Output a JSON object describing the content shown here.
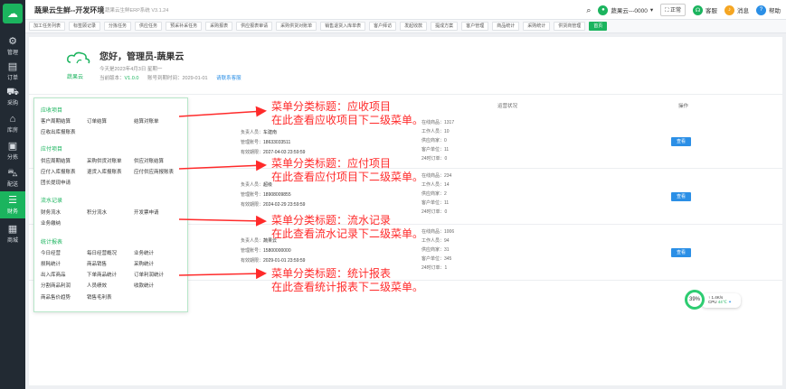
{
  "sidebar": {
    "items": [
      {
        "label": "管理",
        "icon": "gear-icon"
      },
      {
        "label": "订单",
        "icon": "document-icon"
      },
      {
        "label": "采购",
        "icon": "cart-icon"
      },
      {
        "label": "库房",
        "icon": "home-icon"
      },
      {
        "label": "分拣",
        "icon": "box-icon"
      },
      {
        "label": "配送",
        "icon": "truck-icon"
      },
      {
        "label": "财务",
        "icon": "database-icon"
      },
      {
        "label": "商城",
        "icon": "grid-icon"
      }
    ]
  },
  "header": {
    "title": "蔬果云生鲜--开发环境",
    "subtitle": "蔬果云生鲜ERP系统  V3.1.24",
    "user": "蔬果云---0000",
    "mode": "正常",
    "service": "客服",
    "message": "消息",
    "help": "帮助"
  },
  "tabs": [
    "加工任务列表",
    "标签顾记录",
    "分拣任务",
    "供应任务",
    "预采补采任务",
    "采购报表",
    "供应报表审请",
    "采购供货对账单",
    "销售退货入库单表",
    "客户拜访",
    "发起收款",
    "提成方案",
    "客户管理",
    "商品统计",
    "采购统计",
    "供货商管理",
    "首页"
  ],
  "welcome": {
    "hello": "您好，管理员-蔬果云",
    "logo_text": "蔬果云",
    "date": "今天是2023年4月3日 星期一",
    "version_label": "当前版本：",
    "version": "V1.0.0",
    "expire": "账号到期时间：2029-01-01",
    "renew": "请联系客服"
  },
  "table": {
    "col_status": "运营状况",
    "col_action": "操作"
  },
  "rows": [
    {
      "person_label": "负责人员：",
      "person": "车建南",
      "phone_label": "管理账号：",
      "phone": "18633033511",
      "valid_label": "有效期限：",
      "valid": "2027-04-03 23:59:59",
      "stats": [
        "在线商品：1317",
        "工作人员：10",
        "供应商家：0",
        "客户单位：11",
        "24时订单：0"
      ]
    },
    {
      "person_label": "负责人员：",
      "person": "超级",
      "phone_label": "管理账号：",
      "phone": "18908009855",
      "valid_label": "有效期限：",
      "valid": "2024-02-29 23:59:59",
      "stats": [
        "在线商品：234",
        "工作人员：14",
        "供应商家：2",
        "客户单位：11",
        "24时订单：0"
      ]
    },
    {
      "person_label": "负责人员：",
      "person": "蔬果云",
      "phone_label": "管理账号：",
      "phone": "15800000000",
      "valid_label": "有效期限：",
      "valid": "2029-01-01 23:59:59",
      "stats": [
        "在线商品：1006",
        "工作人员：94",
        "供应商家：31",
        "客户单位：345",
        "24时订单：1"
      ]
    }
  ],
  "view_label": "查看",
  "menu": {
    "sections": [
      {
        "title": "应收项目",
        "items": [
          [
            "客户周期结算",
            "订单结算",
            "结算对账单"
          ],
          [
            "应收出库报账表"
          ]
        ]
      },
      {
        "title": "应付项目",
        "items": [
          [
            "供应周期结算",
            "采购供货对账单",
            "供应对账结算"
          ],
          [
            "应付入库报账表",
            "退货入库报账表",
            "应付供应商报账表"
          ],
          [
            "团长提现申请"
          ]
        ]
      },
      {
        "title": "流水记录",
        "items": [
          [
            "财务流水",
            "积分流水",
            "开发票申请"
          ],
          [
            "业务缴纳"
          ]
        ]
      },
      {
        "title": "统计报表",
        "items": [
          [
            "今日经营",
            "每日经营概况",
            "业务统计"
          ],
          [
            "损耗统计",
            "商品销售",
            "采购统计"
          ],
          [
            "出入库商品",
            "下单商品统计",
            "订单利润统计"
          ],
          [
            "分割商品利润",
            "人员绩效",
            "收款统计"
          ],
          [
            "商品售价趋势",
            "销售毛利表"
          ]
        ]
      }
    ]
  },
  "annotations": [
    {
      "line1": "菜单分类标题：应收项目",
      "line2": "在此查看应收项目下二级菜单。"
    },
    {
      "line1": "菜单分类标题：应付项目",
      "line2": "在此查看应付项目下二级菜单。"
    },
    {
      "line1": "菜单分类标题：流水记录",
      "line2": "在此查看流水记录下二级菜单。"
    },
    {
      "line1": "菜单分类标题：统计报表",
      "line2": "在此查看统计报表下二级菜单。"
    }
  ],
  "cpu": {
    "percent": "39%",
    "speed": "1.4K/s",
    "label_cpu": "CPU",
    "cpu_value": "44℃"
  },
  "colors": {
    "accent": "#1bb45e",
    "annotation": "#ff2a2a",
    "link": "#2b8fe6",
    "sidebar": "#222a33"
  }
}
